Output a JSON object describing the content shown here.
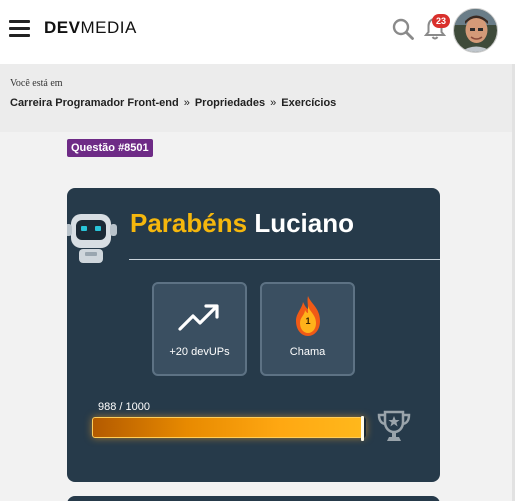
{
  "header": {
    "logo_bold": "DEV",
    "logo_thin": "MEDIA",
    "notifications_count": "23",
    "icons": {
      "menu": "hamburger-icon",
      "search": "search-icon",
      "bell": "bell-icon"
    }
  },
  "breadcrumb": {
    "label": "Você está em",
    "items": [
      "Carreira Programador Front-end",
      "Propriedades",
      "Exercícios"
    ],
    "separator": "»"
  },
  "question": {
    "tag": "Questão #8501"
  },
  "card": {
    "congrats_word": "Parabéns",
    "user_name": "Luciano",
    "stats": [
      {
        "icon": "trending-up-icon",
        "label": "+20 devUPs"
      },
      {
        "icon": "flame-icon",
        "label": "Chama",
        "level": "1"
      }
    ],
    "progress": {
      "text": "988 / 1000",
      "current": 988,
      "max": 1000
    },
    "trophy_icon": "trophy-icon"
  },
  "colors": {
    "card_bg": "#263a4a",
    "accent_yellow": "#f5b70d",
    "tag_purple": "#6e2b86",
    "badge_red": "#d9302c",
    "progress_orange": "#ffa812"
  }
}
